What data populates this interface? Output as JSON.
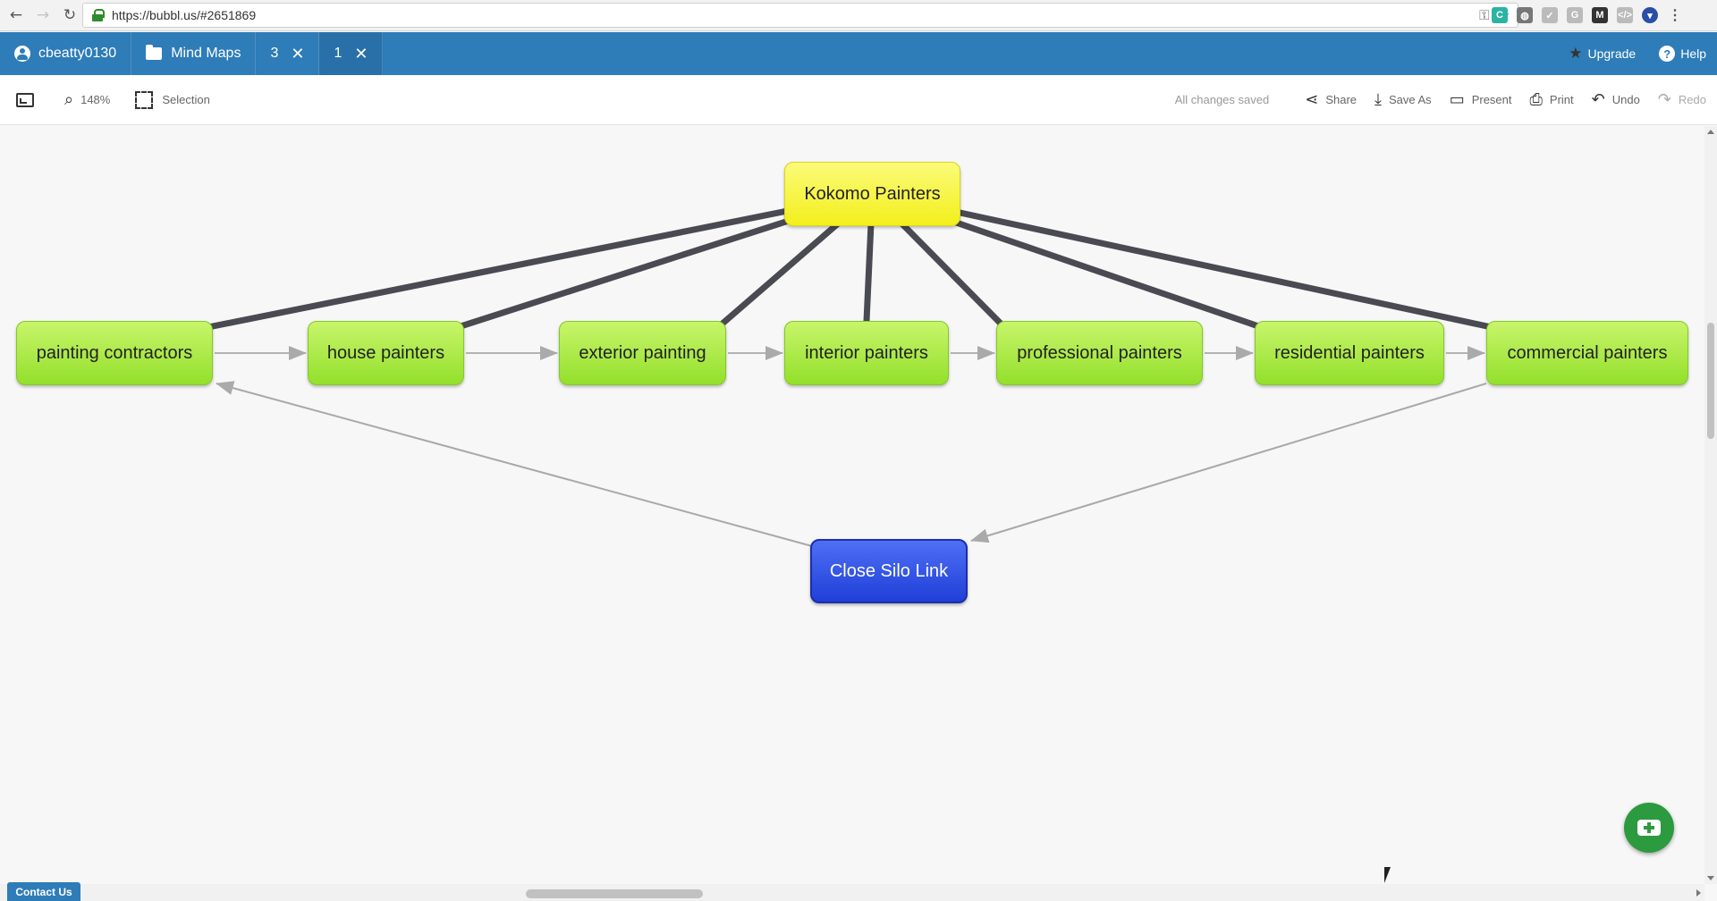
{
  "browser": {
    "url": "https://bubbl.us/#2651869",
    "back_icon": "back-arrow-icon",
    "forward_icon": "forward-arrow-icon",
    "reload_icon": "reload-icon"
  },
  "appbar": {
    "username": "cbeatty0130",
    "mind_maps_label": "Mind Maps",
    "tabs": [
      {
        "label": "3"
      },
      {
        "label": "1"
      }
    ],
    "upgrade_label": "Upgrade",
    "help_label": "Help"
  },
  "toolbar": {
    "zoom": "148%",
    "selection_label": "Selection",
    "status": "All changes saved",
    "share_label": "Share",
    "save_as_label": "Save As",
    "present_label": "Present",
    "print_label": "Print",
    "undo_label": "Undo",
    "redo_label": "Redo"
  },
  "mindmap": {
    "root": {
      "label": "Kokomo Painters",
      "color": "#f3ef1c"
    },
    "children": [
      {
        "label": "painting contractors"
      },
      {
        "label": "house painters"
      },
      {
        "label": "exterior painting"
      },
      {
        "label": "interior painters"
      },
      {
        "label": "professional painters"
      },
      {
        "label": "residential painters"
      },
      {
        "label": "commercial painters"
      }
    ],
    "silo": {
      "label": "Close Silo Link",
      "color": "#1f3fd8"
    },
    "child_color": "#93e02b"
  },
  "footer": {
    "contact_label": "Contact Us"
  }
}
